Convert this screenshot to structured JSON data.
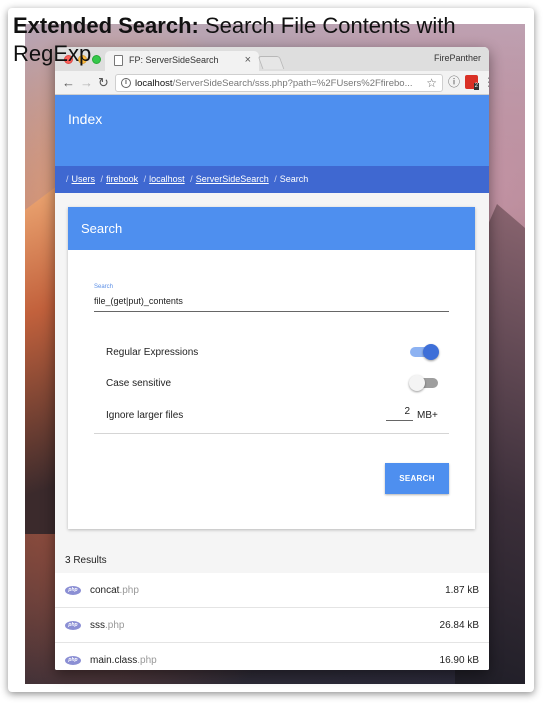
{
  "caption": {
    "bold": "Extended Search:",
    "rest": " Search File Contents with RegExp"
  },
  "browser": {
    "tab_title": "FP: ServerSideSearch",
    "tab_close": "×",
    "profile_name": "FirePanther",
    "url_host": "localhost",
    "url_path": "/ServerSideSearch/sss.php?path=%2FUsers%2Ffirebo...",
    "info_glyph": "i",
    "star_glyph": "☆",
    "ext_info_glyph": "ⓘ",
    "ext_badge_count": "2",
    "menu_glyph": "⋮",
    "back_glyph": "←",
    "forward_glyph": "→",
    "reload_glyph": "↻"
  },
  "app": {
    "title": "Index",
    "breadcrumbs": [
      {
        "label": "Users"
      },
      {
        "label": "firebook"
      },
      {
        "label": "localhost"
      },
      {
        "label": "ServerSideSearch"
      }
    ],
    "breadcrumb_current": "Search",
    "breadcrumb_separator": "/"
  },
  "search_panel": {
    "title": "Search",
    "field_label": "Search",
    "field_value": "file_(get|put)_contents",
    "options": {
      "regex_label": "Regular Expressions",
      "regex_enabled": true,
      "case_label": "Case sensitive",
      "case_enabled": false,
      "ignore_label": "Ignore larger files",
      "ignore_value": "2",
      "ignore_unit": "MB+"
    },
    "button_label": "SEARCH"
  },
  "results": {
    "count_label": "3 Results",
    "icon_label": "php",
    "items": [
      {
        "name": "concat",
        "ext": ".php",
        "size": "1.87 kB"
      },
      {
        "name": "sss",
        "ext": ".php",
        "size": "26.84 kB"
      },
      {
        "name": "main.class",
        "ext": ".php",
        "size": "16.90 kB"
      }
    ]
  },
  "colors": {
    "header_blue": "#4e8fef",
    "breadcrumb_blue": "#3f68d1",
    "toggle_on": "#3e6fd8"
  }
}
